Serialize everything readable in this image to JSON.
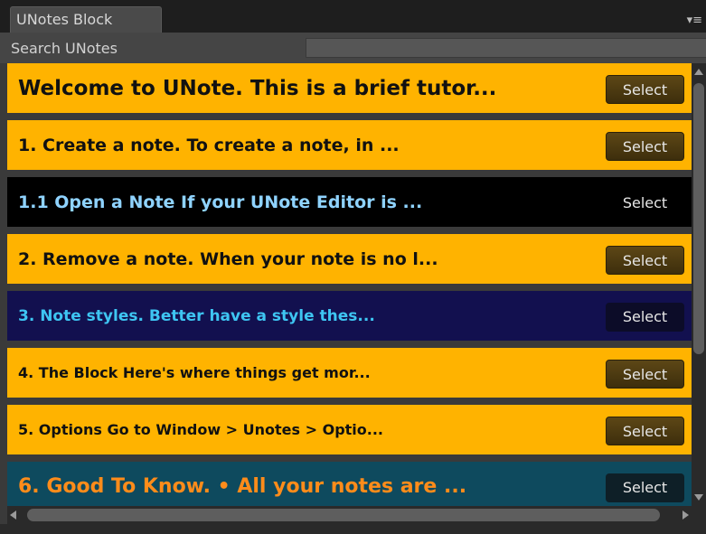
{
  "window": {
    "tab_title": "UNotes Block",
    "menu_icon": "menu-icon"
  },
  "search": {
    "label": "Search UNotes",
    "value": "",
    "placeholder": ""
  },
  "notes": [
    {
      "title": "Welcome to UNote.  This is a brief tutor...",
      "button": "Select",
      "bg": "#ffb300",
      "fg": "#111111",
      "btn_style": "dark"
    },
    {
      "title": "1. Create a note.  To create a note, in ...",
      "button": "Select",
      "bg": "#ffb300",
      "fg": "#111111",
      "btn_style": "dark"
    },
    {
      "title": "1.1 Open a Note If your UNote Editor is ...",
      "button": "Select",
      "bg": "#000000",
      "fg": "#8fd3ff",
      "btn_style": "plain"
    },
    {
      "title": "2. Remove a note. When your note is no l...",
      "button": "Select",
      "bg": "#ffb300",
      "fg": "#111111",
      "btn_style": "dark"
    },
    {
      "title": "3. Note styles. Better have a style thes...",
      "button": "Select",
      "bg": "#12104f",
      "fg": "#3ec5f2",
      "btn_style": "navy"
    },
    {
      "title": "4. The Block Here's where things get mor...",
      "button": "Select",
      "bg": "#ffb300",
      "fg": "#111111",
      "btn_style": "dark"
    },
    {
      "title": "5. Options Go to Window > Unotes > Optio...",
      "button": "Select",
      "bg": "#ffb300",
      "fg": "#111111",
      "btn_style": "dark"
    },
    {
      "title": "6. Good To Know.   • All your notes are ...",
      "button": "Select",
      "bg": "#0e4a5e",
      "fg": "#ff8c1a",
      "btn_style": "teal"
    }
  ],
  "colors": {
    "accent_yellow": "#ffb300",
    "panel": "#3a3a3a",
    "tabbar": "#1e1e1e"
  }
}
